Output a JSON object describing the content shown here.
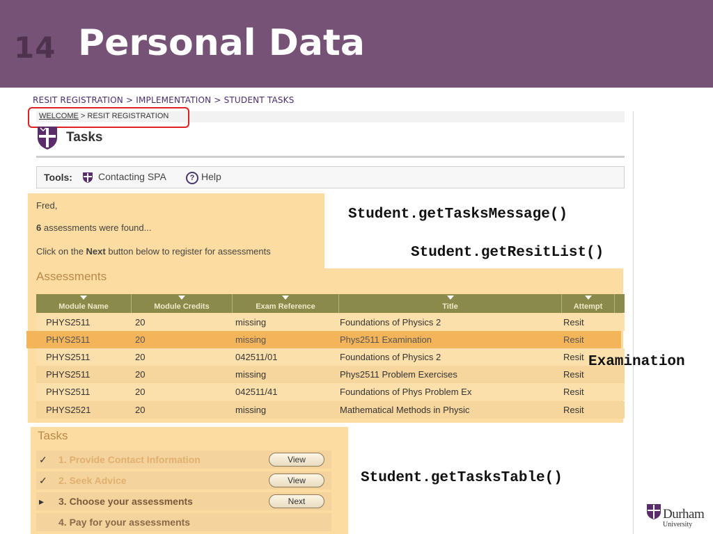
{
  "slide": {
    "number": "14",
    "title": "Personal Data"
  },
  "breadcrumb_top": "RESIT REGISTRATION > IMPLEMENTATION > STUDENT TASKS",
  "screenshot": {
    "welcome_link": "WELCOME",
    "welcome_rest": " > RESIT REGISTRATION",
    "page_heading": "Tasks",
    "tools": {
      "label": "Tools:",
      "contacting": "Contacting SPA",
      "help": "Help"
    },
    "message": {
      "name": "Fred,",
      "count": "6",
      "count_rest": " assessments were found...",
      "click_pre": "Click on the ",
      "click_bold": "Next",
      "click_post": " button below to register for assessments"
    },
    "assessments": {
      "title": "Assessments",
      "columns": [
        "Module Name",
        "Module Credits",
        "Exam Reference",
        "Title",
        "Attempt"
      ],
      "rows": [
        [
          "PHYS2511",
          "20",
          "missing",
          "Foundations of Physics 2",
          "Resit"
        ],
        [
          "PHYS2511",
          "20",
          "missing",
          "Phys2511 Examination",
          "Resit"
        ],
        [
          "PHYS2511",
          "20",
          "042511/01",
          "Foundations of Physics 2",
          "Resit"
        ],
        [
          "PHYS2511",
          "20",
          "missing",
          "Phys2511 Problem Exercises",
          "Resit"
        ],
        [
          "PHYS2511",
          "20",
          "042511/41",
          "Foundations of Phys Problem Ex",
          "Resit"
        ],
        [
          "PHYS2521",
          "20",
          "missing",
          "Mathematical Methods in Physic",
          "Resit"
        ]
      ]
    },
    "tasks": {
      "title": "Tasks",
      "items": [
        {
          "mark": "✓",
          "label": "1. Provide Contact Information",
          "button": "View"
        },
        {
          "mark": "✓",
          "label": "2. Seek Advice",
          "button": "View"
        },
        {
          "mark": "▸",
          "label": "3. Choose your assessments",
          "button": "Next"
        },
        {
          "mark": "",
          "label": "4. Pay for your assessments",
          "button": ""
        }
      ]
    }
  },
  "annotations": {
    "tasks_message": "Student.getTasksMessage()",
    "resit_list": "Student.getResitList()",
    "examination": "Examination",
    "tasks_table": "Student.getTasksTable()"
  },
  "logo": {
    "name": "Durham",
    "sub": "University"
  },
  "colors": {
    "header_bg": "#765376",
    "panel_highlight": "#fcdca0",
    "row_highlight": "#f4b45a",
    "red_box": "#e02020"
  }
}
